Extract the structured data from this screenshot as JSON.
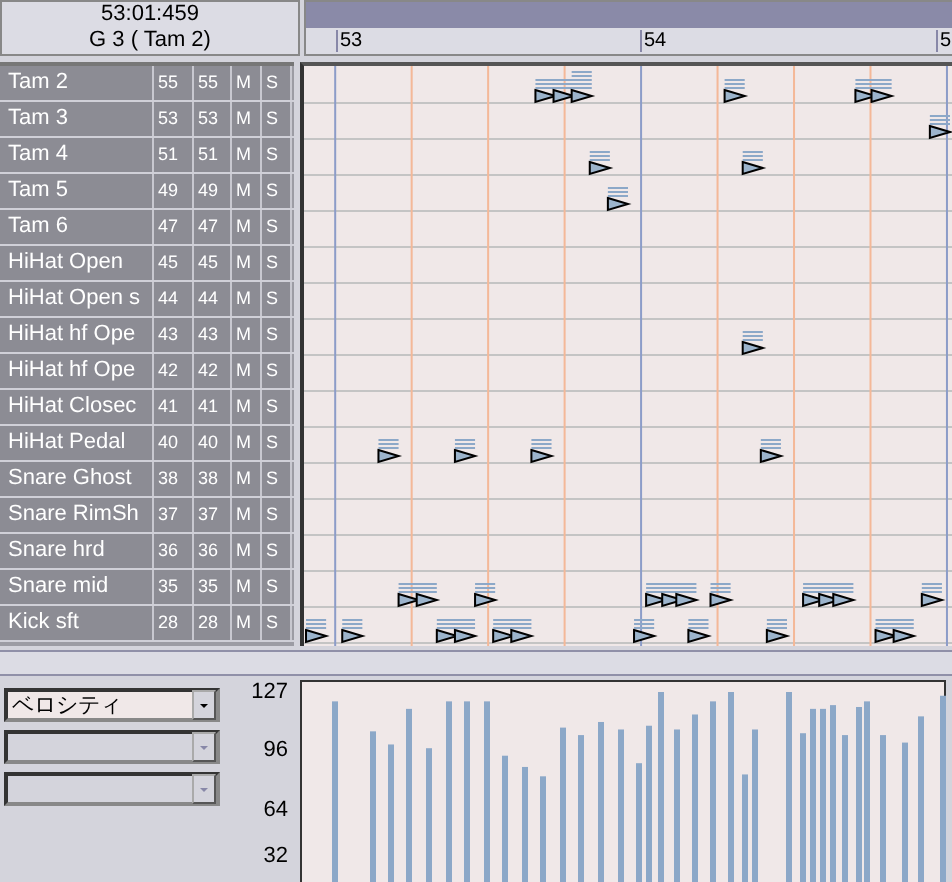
{
  "header": {
    "time": "53:01:459",
    "note": "G 3 ( Tam 2)"
  },
  "ruler": {
    "marks": [
      "53",
      "54",
      "5"
    ]
  },
  "tracks": [
    {
      "name": "Tam 2",
      "note_in": "55",
      "note_out": "55",
      "mute": "M",
      "solo": "S"
    },
    {
      "name": "Tam 3",
      "note_in": "53",
      "note_out": "53",
      "mute": "M",
      "solo": "S"
    },
    {
      "name": "Tam 4",
      "note_in": "51",
      "note_out": "51",
      "mute": "M",
      "solo": "S"
    },
    {
      "name": "Tam 5",
      "note_in": "49",
      "note_out": "49",
      "mute": "M",
      "solo": "S"
    },
    {
      "name": "Tam 6",
      "note_in": "47",
      "note_out": "47",
      "mute": "M",
      "solo": "S"
    },
    {
      "name": "HiHat Open",
      "note_in": "45",
      "note_out": "45",
      "mute": "M",
      "solo": "S"
    },
    {
      "name": "HiHat Open s",
      "note_in": "44",
      "note_out": "44",
      "mute": "M",
      "solo": "S"
    },
    {
      "name": "HiHat hf Ope",
      "note_in": "43",
      "note_out": "43",
      "mute": "M",
      "solo": "S"
    },
    {
      "name": "HiHat hf Ope",
      "note_in": "42",
      "note_out": "42",
      "mute": "M",
      "solo": "S"
    },
    {
      "name": "HiHat Closec",
      "note_in": "41",
      "note_out": "41",
      "mute": "M",
      "solo": "S"
    },
    {
      "name": "HiHat Pedal",
      "note_in": "40",
      "note_out": "40",
      "mute": "M",
      "solo": "S"
    },
    {
      "name": "Snare Ghost",
      "note_in": "38",
      "note_out": "38",
      "mute": "M",
      "solo": "S"
    },
    {
      "name": "Snare RimSh",
      "note_in": "37",
      "note_out": "37",
      "mute": "M",
      "solo": "S"
    },
    {
      "name": "Snare hrd",
      "note_in": "36",
      "note_out": "36",
      "mute": "M",
      "solo": "S"
    },
    {
      "name": "Snare mid",
      "note_in": "35",
      "note_out": "35",
      "mute": "M",
      "solo": "S"
    },
    {
      "name": "Kick sft",
      "note_in": "28",
      "note_out": "28",
      "mute": "M",
      "solo": "S"
    }
  ],
  "controllers": [
    {
      "value": "ベロシティ",
      "disabled": false
    },
    {
      "disabled": true
    },
    {
      "disabled": true
    }
  ],
  "velocity": {
    "scale": [
      "127",
      "96",
      "64",
      "32"
    ]
  }
}
